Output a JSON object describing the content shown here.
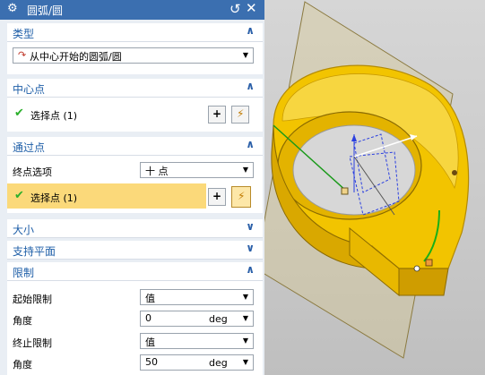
{
  "dialog": {
    "title": "圆弧/圆",
    "reset_icon": "reset-icon",
    "close_icon": "close-icon"
  },
  "sections": {
    "type": {
      "header": "类型",
      "value": "从中心开始的圆弧/圆"
    },
    "center": {
      "header": "中心点",
      "select_label": "选择点 (1)"
    },
    "through": {
      "header": "通过点",
      "endpoint_option_label": "终点选项",
      "endpoint_option_value": "十 点",
      "select_label": "选择点 (1)"
    },
    "size": {
      "header": "大小"
    },
    "support_plane": {
      "header": "支持平面"
    },
    "limits": {
      "header": "限制",
      "start_limit_label": "起始限制",
      "start_limit_value": "值",
      "start_angle_label": "角度",
      "start_angle_value": "0",
      "end_limit_label": "终止限制",
      "end_limit_value": "值",
      "end_angle_label": "角度",
      "end_angle_value": "50",
      "unit": "deg"
    }
  },
  "colors": {
    "title_bar": "#3b6fb0",
    "section_header_text": "#1f5fa8",
    "selected_row": "#fbd97a",
    "part_yellow": "#f2c400",
    "check_green": "#2bb02b"
  }
}
